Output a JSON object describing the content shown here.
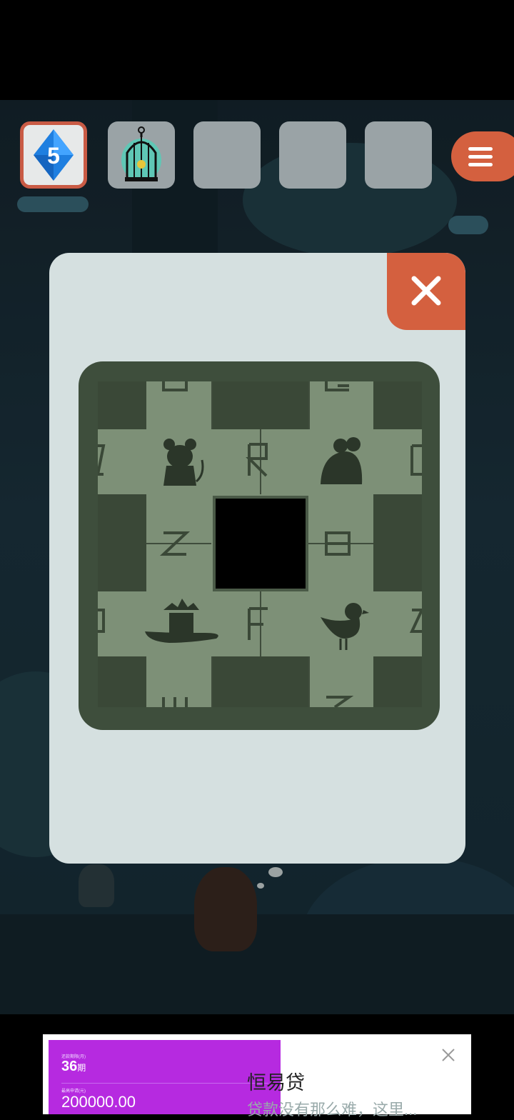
{
  "inventory": {
    "slots": [
      {
        "item": "blue-diamond-5-icon",
        "label": "5",
        "selected": true
      },
      {
        "item": "birdcage-icon",
        "selected": false
      },
      {
        "item": "empty",
        "selected": false
      },
      {
        "item": "empty",
        "selected": false
      },
      {
        "item": "empty",
        "selected": false
      }
    ]
  },
  "puzzle": {
    "pieces": [
      "mouse",
      "frog",
      "bird",
      "fountain"
    ],
    "letters": [
      "Z",
      "R",
      "D",
      "Z",
      "B",
      "D",
      "F",
      "Z"
    ]
  },
  "ad": {
    "term_label": "还款期限(月)",
    "term_value": "36",
    "term_unit": "期",
    "amount_label": "最高申请(元)",
    "amount_value": "200000.00",
    "title": "恒易贷",
    "description": "贷款没有那么难，这里..."
  },
  "colors": {
    "accent": "#d4603f",
    "modal": "#d5e0e0",
    "puzzle_frame": "#3e4e3c",
    "ad_purple": "#b62ae0"
  }
}
